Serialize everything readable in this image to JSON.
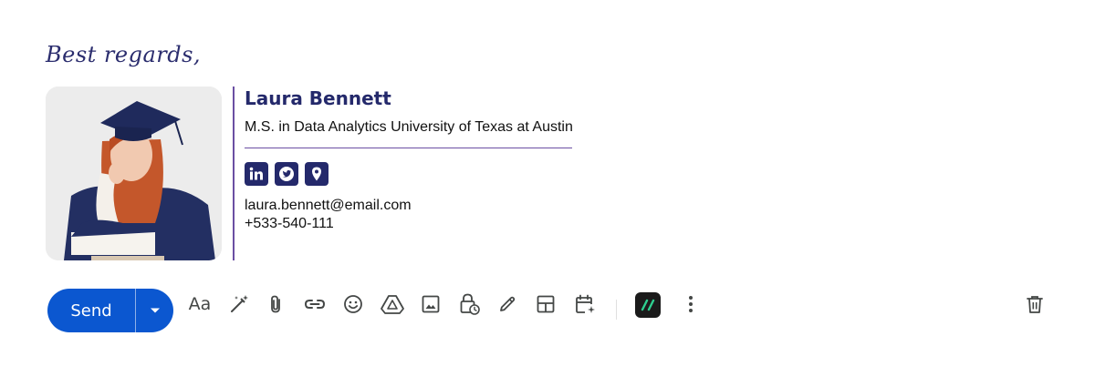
{
  "signature": {
    "closing": "Best regards,",
    "name": "Laura Bennett",
    "degree": "M.S. in Data Analytics University of Texas at Austin",
    "email": "laura.bennett@email.com",
    "phone": "+533-540-111",
    "socials": [
      "linkedin-icon",
      "twitter-icon",
      "location-icon"
    ],
    "accent_color": "#24296b",
    "divider_color": "#6b4fa3"
  },
  "toolbar": {
    "send_label": "Send",
    "format_label": "Aa",
    "send_color": "#0b57d0",
    "icons": [
      "formatting-options",
      "help-me-write-icon",
      "attach-icon",
      "link-icon",
      "emoji-icon",
      "drive-icon",
      "photo-icon",
      "confidential-mode-icon",
      "signature-icon",
      "layouts-icon",
      "schedule-event-icon",
      "extension-icon",
      "more-options-icon",
      "trash-icon"
    ]
  }
}
